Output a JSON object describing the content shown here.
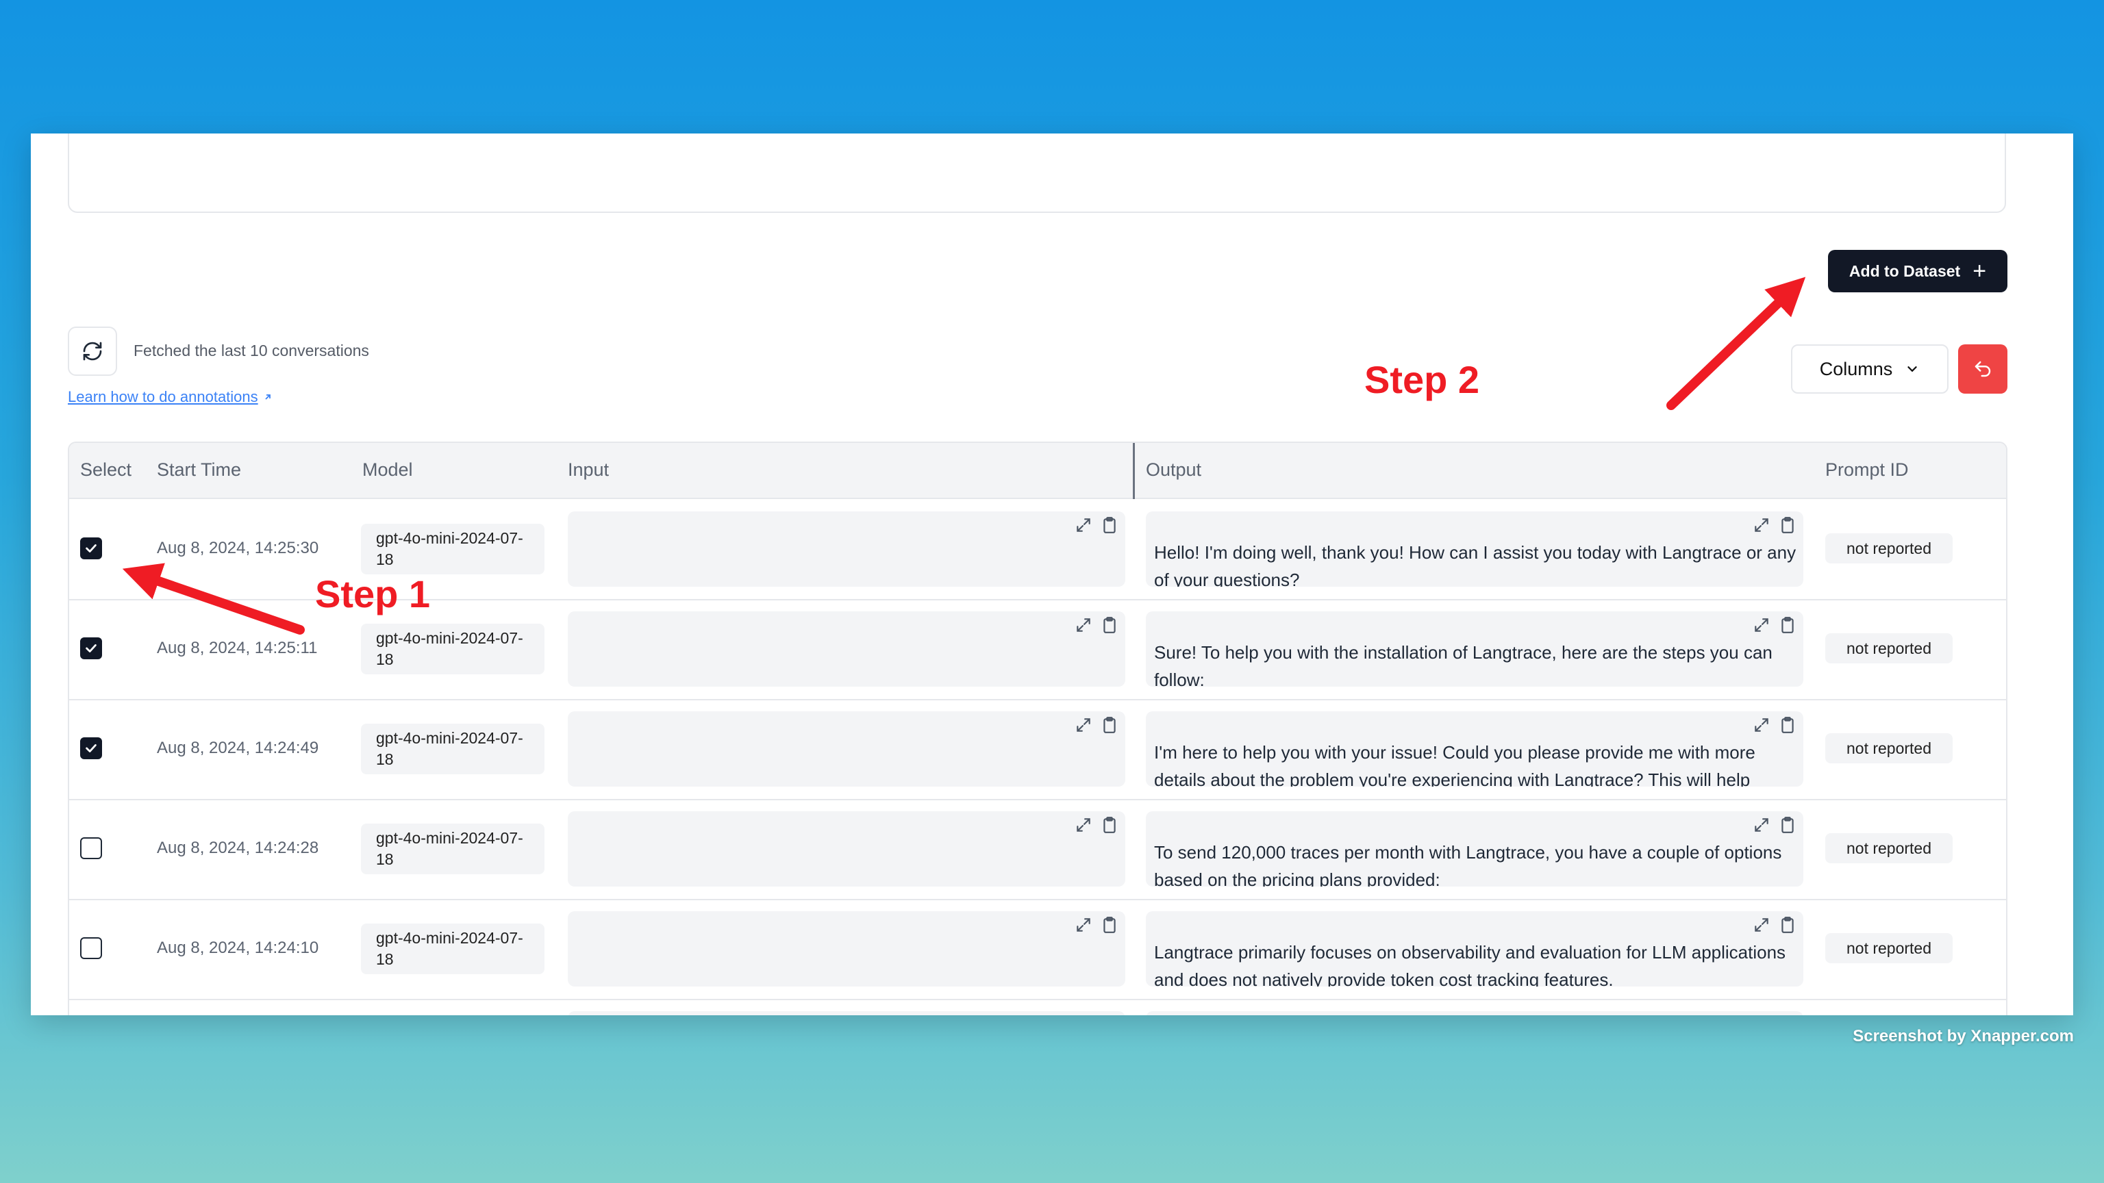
{
  "toolbar": {
    "add_to_dataset_label": "Add to Dataset",
    "fetched_text": "Fetched the last 10 conversations",
    "learn_link": "Learn how to do annotations",
    "columns_label": "Columns"
  },
  "annotations": {
    "step1": "Step 1",
    "step2": "Step 2"
  },
  "table": {
    "headers": {
      "select": "Select",
      "start_time": "Start Time",
      "model": "Model",
      "input": "Input",
      "output": "Output",
      "prompt_id": "Prompt ID"
    },
    "rows": [
      {
        "checked": true,
        "time": "Aug 8, 2024, 14:25:30",
        "model": "gpt-4o-mini-2024-07-18",
        "output": "Hello! I'm doing well, thank you! How can I assist you today with Langtrace or any of your questions?",
        "prompt_id": "not reported"
      },
      {
        "checked": true,
        "time": "Aug 8, 2024, 14:25:11",
        "model": "gpt-4o-mini-2024-07-18",
        "output": "Sure! To help you with the installation of Langtrace, here are the steps you can follow:",
        "prompt_id": "not reported"
      },
      {
        "checked": true,
        "time": "Aug 8, 2024, 14:24:49",
        "model": "gpt-4o-mini-2024-07-18",
        "output": "I'm here to help you with your issue! Could you please provide me with more details about the problem you're experiencing with Langtrace? This will help",
        "prompt_id": "not reported"
      },
      {
        "checked": false,
        "time": "Aug 8, 2024, 14:24:28",
        "model": "gpt-4o-mini-2024-07-18",
        "output": "To send 120,000 traces per month with Langtrace, you have a couple of options based on the pricing plans provided:",
        "prompt_id": "not reported"
      },
      {
        "checked": false,
        "time": "Aug 8, 2024, 14:24:10",
        "model": "gpt-4o-mini-2024-07-18",
        "output": "Langtrace primarily focuses on observability and evaluation for LLM applications and does not natively provide token cost tracking features.",
        "prompt_id": "not reported"
      }
    ]
  },
  "watermark": "Screenshot by Xnapper.com",
  "colors": {
    "primary_button": "#121826",
    "danger_button": "#ef4444",
    "annotation_red": "#ef1c24"
  }
}
